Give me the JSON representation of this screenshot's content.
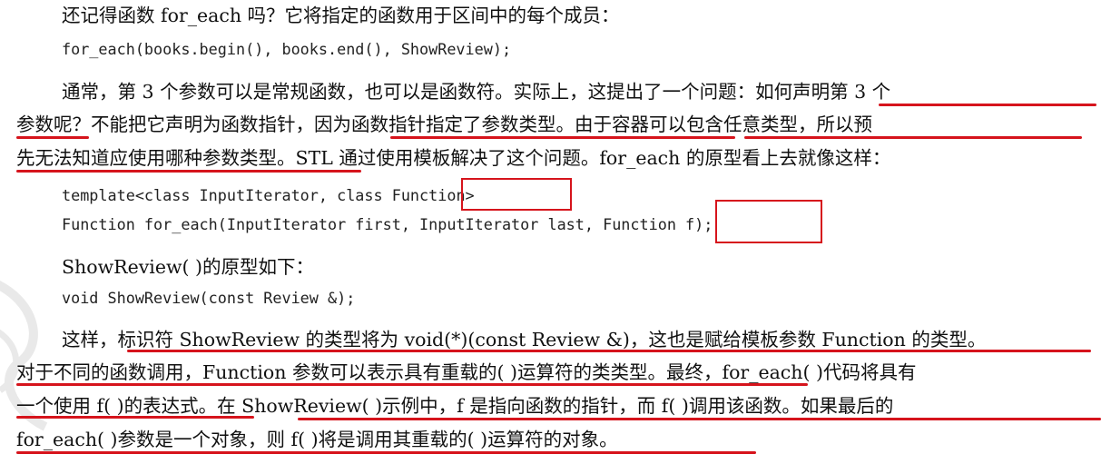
{
  "paragraphs": {
    "p1": "还记得函数 for_each 吗？它将指定的函数用于区间中的每个成员：",
    "code1": "for_each(books.begin(), books.end(), ShowReview);",
    "p2_l1": "通常，第 3 个参数可以是常规函数，也可以是函数符。实际上，这提出了一个问题：如何声明第 3 个",
    "p2_l2": "参数呢？不能把它声明为函数指针，因为函数指针指定了参数类型。由于容器可以包含任意类型，所以预",
    "p2_l3": "先无法知道应使用哪种参数类型。STL 通过使用模板解决了这个问题。for_each 的原型看上去就像这样：",
    "code2_pre": "template<class InputIterator, class ",
    "code2_boxed": "Function>",
    "code3_pre": "Function for_each(InputIterator first, InputIterator last, ",
    "code3_boxed": "Function",
    "code3_post": " f);",
    "p3": "ShowReview( )的原型如下：",
    "code4": "void ShowReview(const Review &);",
    "p4_l1": "这样，标识符 ShowReview 的类型将为 void(*)(const Review &)，这也是赋给模板参数 Function 的类型。",
    "p4_l2": "对于不同的函数调用，Function 参数可以表示具有重载的( )运算符的类类型。最终，for_each( )代码将具有",
    "p4_l3": "一个使用 f( )的表达式。在 ShowReview( )示例中，f 是指向函数的指针，而 f( )调用该函数。如果最后的",
    "p4_l4": "for_each( )参数是一个对象，则 f( )将是调用其重载的( )运算符的对象。"
  },
  "colors": {
    "annotation": "#d6141c"
  }
}
